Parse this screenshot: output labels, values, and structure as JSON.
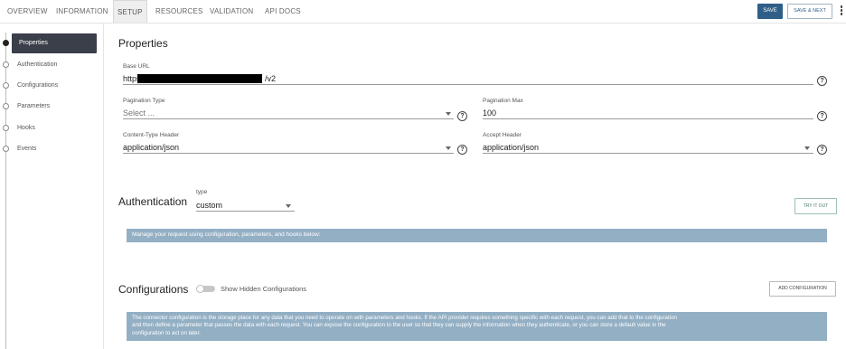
{
  "tabs": [
    {
      "label": "OVERVIEW",
      "active": false
    },
    {
      "label": "INFORMATION",
      "active": false
    },
    {
      "label": "SETUP",
      "active": true
    },
    {
      "label": "RESOURCES",
      "active": false
    },
    {
      "label": "VALIDATION",
      "active": false
    },
    {
      "label": "API DOCS",
      "active": false
    }
  ],
  "toolbar": {
    "save_label": "SAVE",
    "save_next_label": "SAVE & NEXT"
  },
  "sidebar": {
    "items": [
      {
        "label": "Properties",
        "active": true
      },
      {
        "label": "Authentication",
        "active": false
      },
      {
        "label": "Configurations",
        "active": false
      },
      {
        "label": "Parameters",
        "active": false
      },
      {
        "label": "Hooks",
        "active": false
      },
      {
        "label": "Events",
        "active": false
      }
    ]
  },
  "properties": {
    "title": "Properties",
    "base_url": {
      "label": "Base URL",
      "prefix": "https:/.",
      "suffix": "/v2"
    },
    "pagination_type": {
      "label": "Pagination Type",
      "placeholder": "Select ..."
    },
    "pagination_max": {
      "label": "Pagination Max",
      "value": "100"
    },
    "content_type": {
      "label": "Content-Type Header",
      "value": "application/json"
    },
    "accept": {
      "label": "Accept Header",
      "value": "application/json"
    },
    "help_glyph": "?"
  },
  "authentication": {
    "title": "Authentication",
    "type_label": "type",
    "type_value": "custom",
    "try_label": "TRY IT OUT",
    "info": "Manage your request using configuration, parameters, and hooks below:"
  },
  "configurations": {
    "title": "Configurations",
    "toggle_label": "Show Hidden Configurations",
    "toggle_on": false,
    "add_label": "ADD CONFIGURATION",
    "info_lines": [
      "The connector configuration is the storage place for any data that you need to operate on with parameters and hooks. If the API provider requires something specific with each request, you can add that to the configuration",
      "and then define a parameter that passes the data with each request. You can expose the configuration to the user so that they can supply the information when they authenticate, or you can store a default value in the",
      "configuration to act on later."
    ]
  },
  "colors": {
    "primary": "#2f5f88",
    "info_bar": "#93afc4",
    "sidebar_active": "#3a3f4a"
  },
  "icons": {
    "help": "question-circle-icon",
    "dropdown": "chevron-down-icon",
    "menu": "kebab-menu-icon"
  }
}
